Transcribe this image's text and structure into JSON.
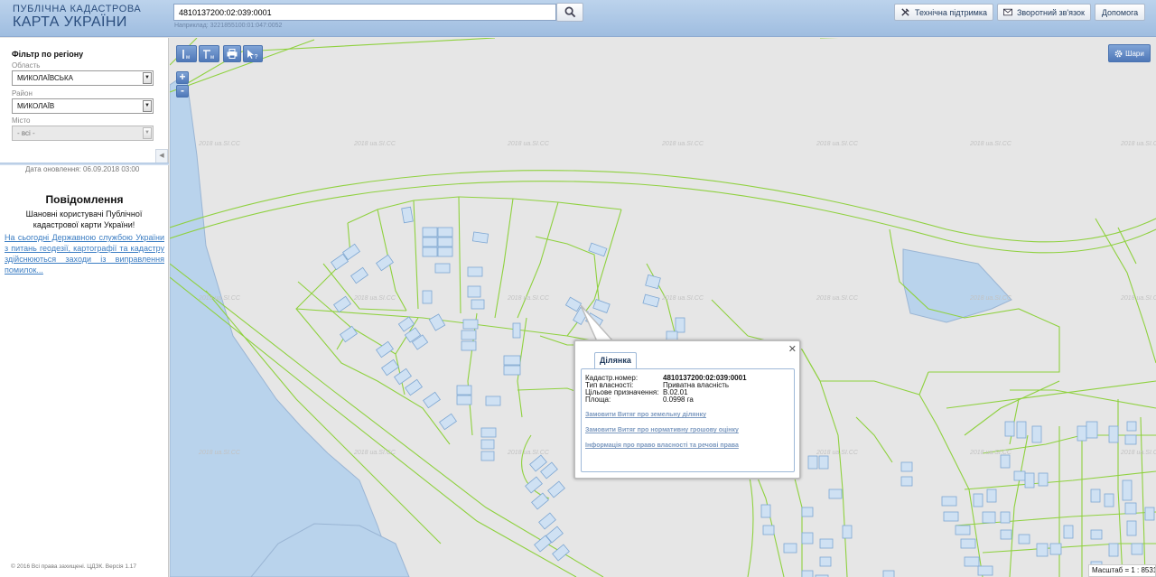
{
  "header": {
    "logo_line1": "ПУБЛІЧНА КАДАСТРОВА",
    "logo_line2": "КАРТА УКРАЇНИ",
    "search_value": "4810137200:02:039:0001",
    "search_hint": "Наприклад: 3221855100:01:047:0052",
    "support_label": "Технічна підтримка",
    "feedback_label": "Зворотний зв'язок",
    "help_label": "Допомога"
  },
  "filter": {
    "title": "Фільтр по регіону",
    "region_label": "Область",
    "region_value": "МИКОЛАЇВСЬКА",
    "district_label": "Район",
    "district_value": "МИКОЛАЇВ",
    "city_label": "Місто",
    "city_value": "- всі -"
  },
  "update_text": "Дата оновлення: 06.09.2018 03:00",
  "news": {
    "title": "Повідомлення",
    "body": "Шановні користувачі Публічної кадастрової карти України!",
    "link": "На сьогодні Державною службою України з питань геодезії, картографії та кадастру здійснюються заходи із виправлення помилок..."
  },
  "copyright": "© 2016 Всі права захищені. ЦДЗК. Версія 1.17",
  "map": {
    "layers_label": "Шари",
    "watermark": "2018 ua.SI.CC",
    "scale_text": "Масштаб = 1 : 8531"
  },
  "popup": {
    "tab": "Ділянка",
    "rows": [
      {
        "key": "Кадастр.номер:",
        "value": "4810137200:02:039:0001"
      },
      {
        "key": "Тип власності:",
        "value": "Приватна власність"
      },
      {
        "key": "Цільове призначення:",
        "value": "В.02.01"
      },
      {
        "key": "Площа:",
        "value": "0.0998 га"
      }
    ],
    "links": [
      "Замовити Витяг про земельну ділянку",
      "Замовити Витяг про нормативну грошову оцінку",
      "Інформація про право власності та речові права"
    ]
  },
  "colors": {
    "parcel_line": "#8fd13f",
    "building_fill": "#cfe1f3",
    "building_stroke": "#7ea7d3",
    "water_fill": "#b9d3ec",
    "link": "#3b7dc3"
  }
}
